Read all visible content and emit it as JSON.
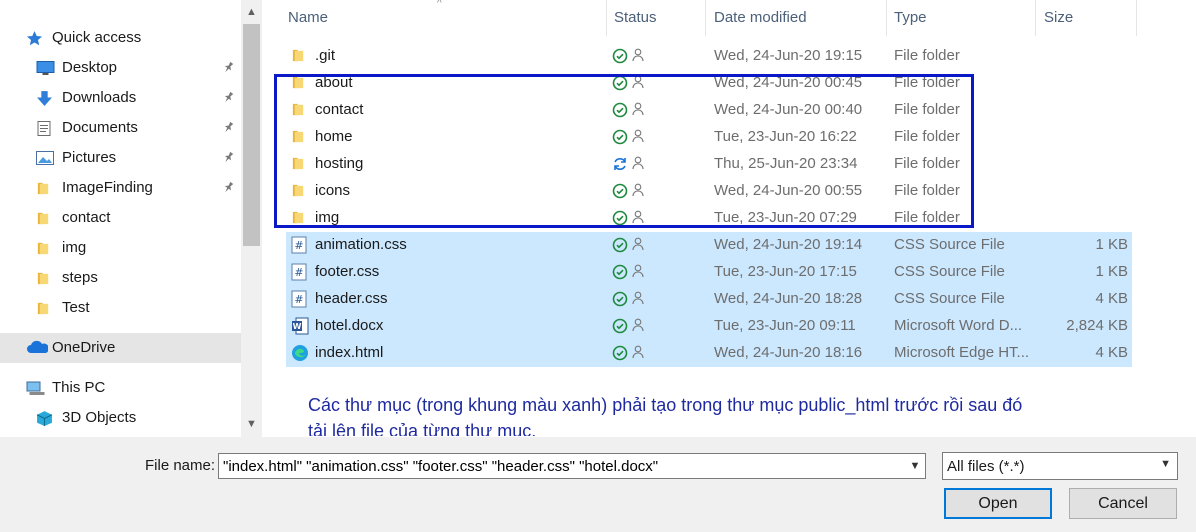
{
  "sidebar": {
    "items": [
      {
        "label": "Quick access",
        "icon": "star-icon",
        "pinned": false
      },
      {
        "label": "Desktop",
        "icon": "desktop-icon",
        "pinned": true
      },
      {
        "label": "Downloads",
        "icon": "download-arrow-icon",
        "pinned": true
      },
      {
        "label": "Documents",
        "icon": "document-icon",
        "pinned": true
      },
      {
        "label": "Pictures",
        "icon": "pictures-icon",
        "pinned": true
      },
      {
        "label": "ImageFinding",
        "icon": "folder-icon",
        "pinned": true
      },
      {
        "label": "contact",
        "icon": "folder-icon",
        "pinned": false
      },
      {
        "label": "img",
        "icon": "folder-icon",
        "pinned": false
      },
      {
        "label": "steps",
        "icon": "folder-icon",
        "pinned": false
      },
      {
        "label": "Test",
        "icon": "folder-icon",
        "pinned": false
      },
      {
        "label": "OneDrive",
        "icon": "cloud-icon",
        "pinned": false,
        "selected": true
      },
      {
        "label": "This PC",
        "icon": "computer-icon",
        "pinned": false
      },
      {
        "label": "3D Objects",
        "icon": "cube-icon",
        "pinned": false
      }
    ]
  },
  "columns": {
    "name": "Name",
    "status": "Status",
    "date": "Date modified",
    "type": "Type",
    "size": "Size"
  },
  "files": [
    {
      "name": ".git",
      "date": "Wed, 24-Jun-20 19:15",
      "type": "File folder",
      "size": "",
      "kind": "folder",
      "status": "synced"
    },
    {
      "name": "about",
      "date": "Wed, 24-Jun-20 00:45",
      "type": "File folder",
      "size": "",
      "kind": "folder",
      "status": "synced"
    },
    {
      "name": "contact",
      "date": "Wed, 24-Jun-20 00:40",
      "type": "File folder",
      "size": "",
      "kind": "folder",
      "status": "synced"
    },
    {
      "name": "home",
      "date": "Tue, 23-Jun-20 16:22",
      "type": "File folder",
      "size": "",
      "kind": "folder",
      "status": "synced"
    },
    {
      "name": "hosting",
      "date": "Thu, 25-Jun-20 23:34",
      "type": "File folder",
      "size": "",
      "kind": "folder",
      "status": "syncing"
    },
    {
      "name": "icons",
      "date": "Wed, 24-Jun-20 00:55",
      "type": "File folder",
      "size": "",
      "kind": "folder",
      "status": "synced"
    },
    {
      "name": "img",
      "date": "Tue, 23-Jun-20 07:29",
      "type": "File folder",
      "size": "",
      "kind": "folder",
      "status": "synced"
    },
    {
      "name": "animation.css",
      "date": "Wed, 24-Jun-20 19:14",
      "type": "CSS Source File",
      "size": "1 KB",
      "kind": "css",
      "status": "synced",
      "selected": true
    },
    {
      "name": "footer.css",
      "date": "Tue, 23-Jun-20 17:15",
      "type": "CSS Source File",
      "size": "1 KB",
      "kind": "css",
      "status": "synced",
      "selected": true
    },
    {
      "name": "header.css",
      "date": "Wed, 24-Jun-20 18:28",
      "type": "CSS Source File",
      "size": "4 KB",
      "kind": "css",
      "status": "synced",
      "selected": true
    },
    {
      "name": "hotel.docx",
      "date": "Tue, 23-Jun-20 09:11",
      "type": "Microsoft Word D...",
      "size": "2,824 KB",
      "kind": "word",
      "status": "synced",
      "selected": true
    },
    {
      "name": "index.html",
      "date": "Wed, 24-Jun-20 18:16",
      "type": "Microsoft Edge HT...",
      "size": "4 KB",
      "kind": "edge",
      "status": "synced",
      "selected": true
    }
  ],
  "annotation": {
    "text": "Các thư mục (trong khung màu xanh) phải tạo trong thư mục public_html trước rồi sau đó tải lên file của từng thư mục.",
    "color": "#1f2aa0",
    "box_color": "#0b18c8"
  },
  "footer": {
    "filename_label": "File name:",
    "filename_value": "\"index.html\" \"animation.css\" \"footer.css\" \"header.css\" \"hotel.docx\"",
    "filetype_value": "All files (*.*)",
    "open_label": "Open",
    "cancel_label": "Cancel"
  },
  "colors": {
    "selection": "#cce8ff",
    "accent": "#0078d7",
    "synced": "#1e8a3e",
    "syncing": "#1a73d9",
    "folder": "#f1c24e"
  }
}
